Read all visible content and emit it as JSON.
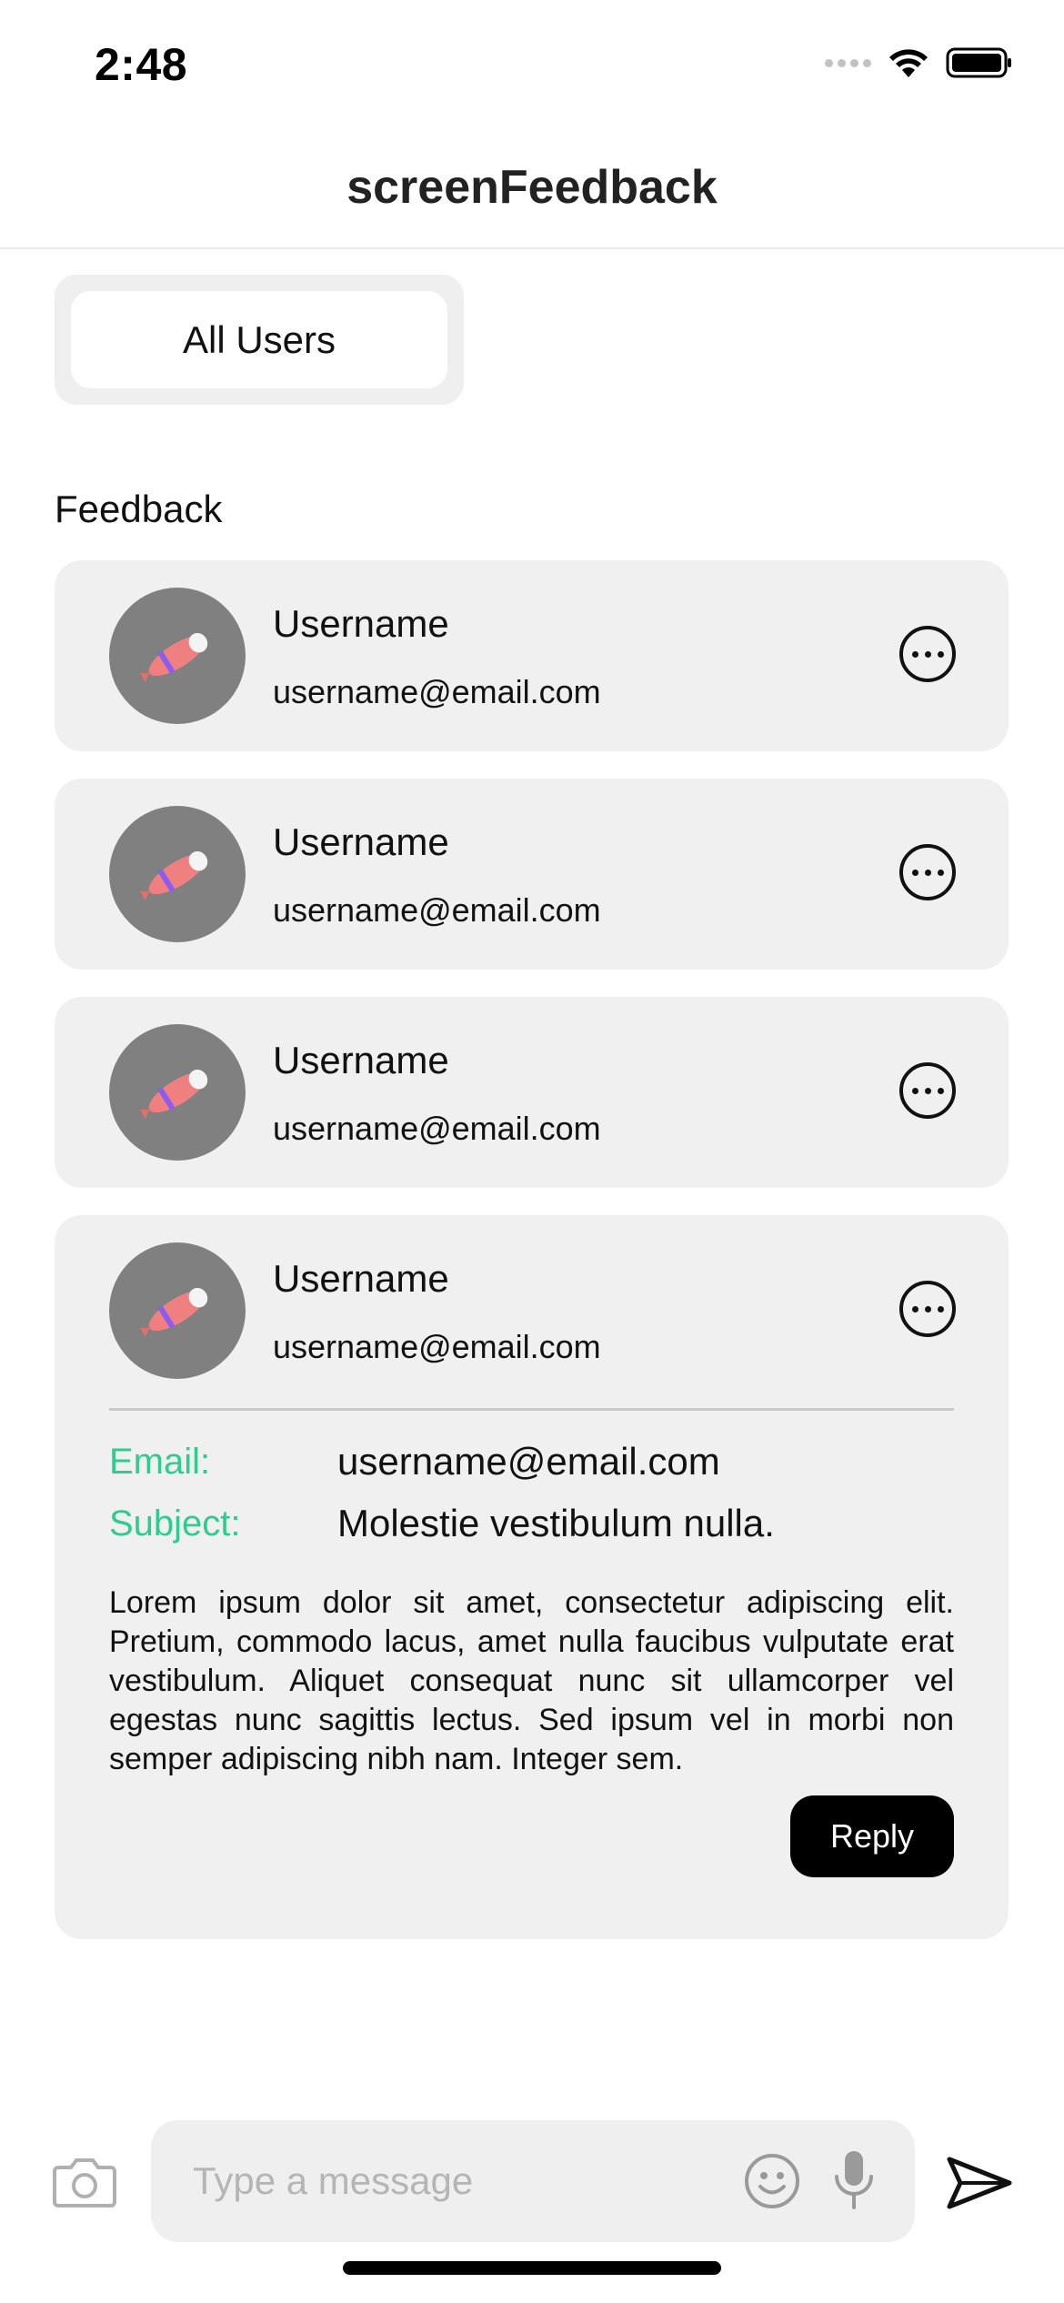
{
  "status_bar": {
    "time": "2:48"
  },
  "nav": {
    "title": "screenFeedback"
  },
  "filter": {
    "selected": "All Users"
  },
  "section": {
    "label": "Feedback"
  },
  "feedback": [
    {
      "name": "Username",
      "email": "username@email.com"
    },
    {
      "name": "Username",
      "email": "username@email.com"
    },
    {
      "name": "Username",
      "email": "username@email.com"
    },
    {
      "name": "Username",
      "email": "username@email.com",
      "expanded": true,
      "detail": {
        "email_label": "Email:",
        "email_value": "username@email.com",
        "subject_label": "Subject:",
        "subject_value": "Molestie vestibulum nulla.",
        "body": "Lorem ipsum dolor sit amet, consectetur adipiscing elit. Pretium, commodo lacus, amet nulla faucibus vulputate erat vestibulum. Aliquet consequat nunc sit ullamcorper vel egestas nunc sagittis lectus. Sed ipsum vel in morbi non semper adipiscing nibh nam. Integer sem.",
        "reply_label": "Reply"
      }
    }
  ],
  "composer": {
    "placeholder": "Type a message"
  },
  "icons": {
    "camera": "camera-icon",
    "emoji": "emoji-icon",
    "mic": "microphone-icon",
    "send": "send-icon",
    "more": "more-icon",
    "avatar": "avatar-icon"
  },
  "colors": {
    "field_label": "#2ecc8f",
    "card_bg": "#f0f0f0",
    "avatar_bg": "#808080"
  }
}
